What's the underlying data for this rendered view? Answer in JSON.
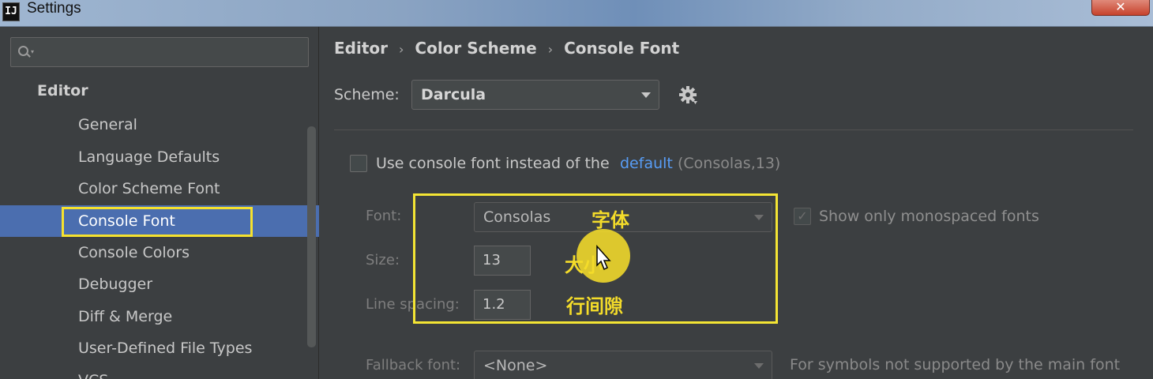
{
  "window": {
    "title": "Settings",
    "app_icon_text": "IJ",
    "close_label": "✕"
  },
  "sidebar": {
    "search_placeholder": "",
    "group": "Editor",
    "items": [
      {
        "label": "General"
      },
      {
        "label": "Language Defaults"
      },
      {
        "label": "Color Scheme Font"
      },
      {
        "label": "Console Font",
        "selected": true
      },
      {
        "label": "Console Colors"
      },
      {
        "label": "Debugger"
      },
      {
        "label": "Diff & Merge"
      },
      {
        "label": "User-Defined File Types"
      },
      {
        "label": "VCS"
      }
    ]
  },
  "breadcrumb": [
    "Editor",
    "Color Scheme",
    "Console Font"
  ],
  "scheme": {
    "label": "Scheme:",
    "value": "Darcula"
  },
  "use_console_font": {
    "checked": false,
    "label": "Use console font instead of the",
    "link": "default",
    "hint": "(Consolas,13)"
  },
  "font": {
    "label": "Font:",
    "value": "Consolas",
    "show_mono_label": "Show only monospaced fonts",
    "show_mono_checked": true
  },
  "size": {
    "label": "Size:",
    "value": "13"
  },
  "line_spacing": {
    "label": "Line spacing:",
    "value": "1.2"
  },
  "fallback": {
    "label": "Fallback font:",
    "value": "<None>",
    "hint": "For symbols not supported by the main font"
  },
  "annotations": {
    "font": "字体",
    "size": "大小",
    "line_spacing": "行间隙"
  },
  "colors": {
    "selection": "#4b6eaf",
    "link": "#589df6",
    "annotation": "#f4e534",
    "background": "#3c3f41"
  }
}
